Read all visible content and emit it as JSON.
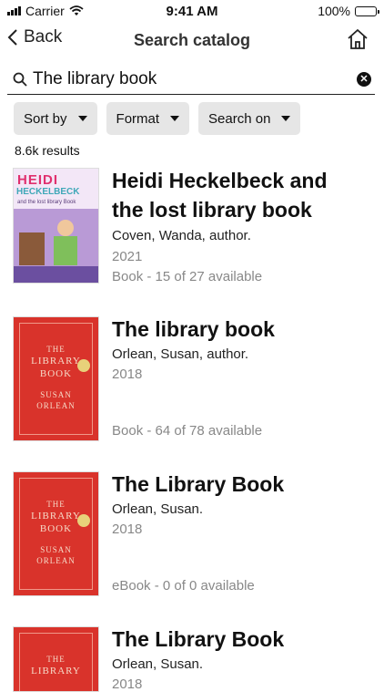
{
  "status": {
    "carrier": "Carrier",
    "time": "9:41 AM",
    "battery": "100%"
  },
  "nav": {
    "back_label": "Back",
    "title": "Search catalog"
  },
  "search": {
    "query": "The library book"
  },
  "filters": [
    {
      "label": "Sort by"
    },
    {
      "label": "Format"
    },
    {
      "label": "Search on"
    }
  ],
  "results_count": "8.6k results",
  "results": [
    {
      "title": "Heidi Heckelbeck and the lost library book",
      "author": "Coven, Wanda, author.",
      "year": "2021",
      "availability": "Book - 15 of 27 available",
      "cover_lines": [
        "HEIDI",
        "HECKELBECK",
        "and the lost library Book"
      ]
    },
    {
      "title": "The library book",
      "author": "Orlean, Susan, author.",
      "year": "2018",
      "availability": "Book - 64 of 78 available",
      "cover_lines": [
        "THE",
        "LIBRARY",
        "BOOK",
        "SUSAN",
        "ORLEAN"
      ]
    },
    {
      "title": "The Library Book",
      "author": "Orlean, Susan.",
      "year": "2018",
      "availability": "eBook - 0 of 0 available",
      "cover_lines": [
        "THE",
        "LIBRARY",
        "BOOK",
        "SUSAN",
        "ORLEAN"
      ]
    },
    {
      "title": "The Library Book",
      "author": "Orlean, Susan.",
      "year": "2018",
      "cover_lines": [
        "THE",
        "LIBRARY"
      ]
    }
  ]
}
